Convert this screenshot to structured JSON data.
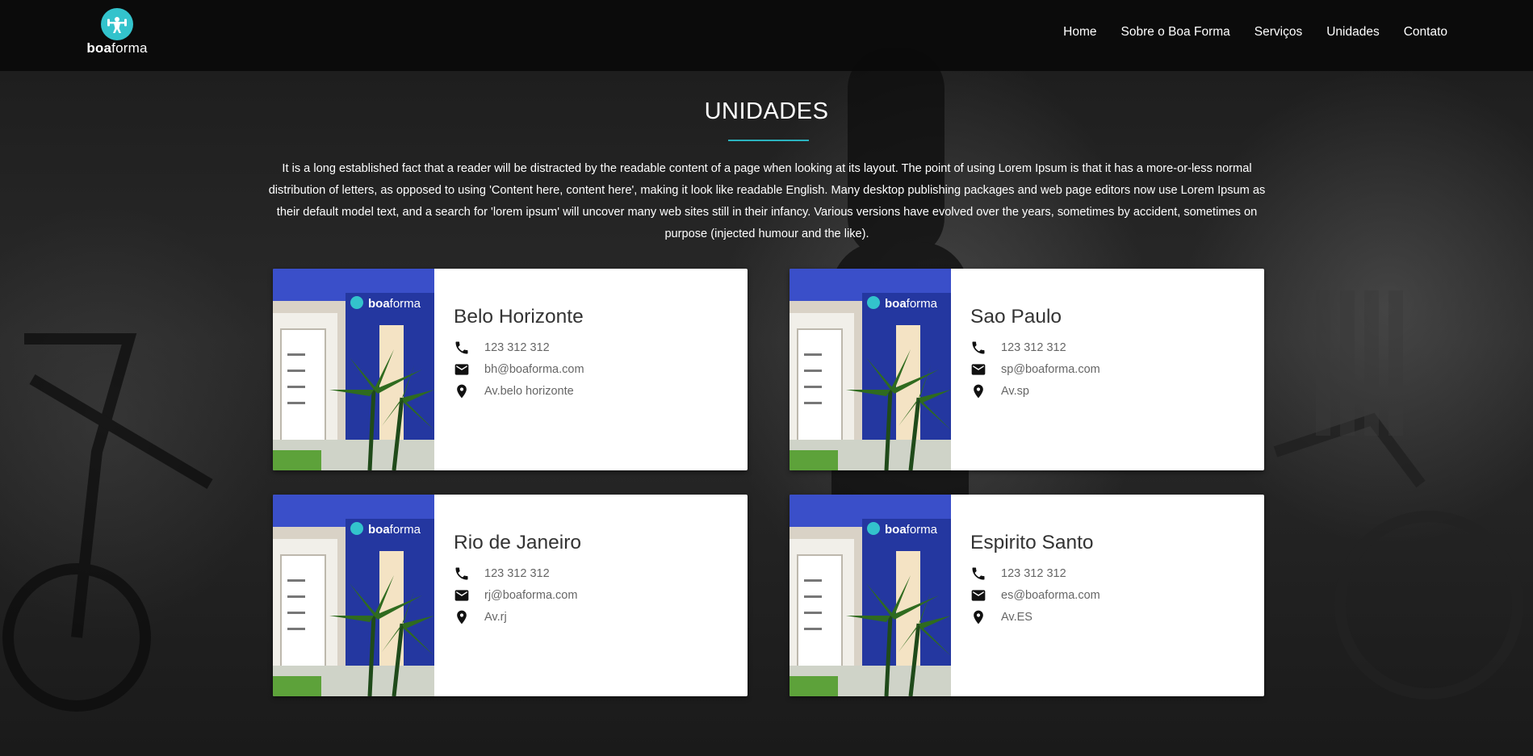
{
  "brand": {
    "logo_bold": "boa",
    "logo_light": "forma"
  },
  "nav": {
    "items": [
      {
        "label": "Home"
      },
      {
        "label": "Sobre o Boa Forma"
      },
      {
        "label": "Serviços"
      },
      {
        "label": "Unidades"
      },
      {
        "label": "Contato"
      }
    ]
  },
  "section": {
    "title": "UNIDADES",
    "intro": "It is a long established fact that a reader will be distracted by the readable content of a page when looking at its layout. The point of using Lorem Ipsum is that it has a more-or-less normal distribution of letters, as opposed to using 'Content here, content here', making it look like readable English. Many desktop publishing packages and web page editors now use Lorem Ipsum as their default model text, and a search for 'lorem ipsum' will uncover many web sites still in their infancy. Various versions have evolved over the years, sometimes by accident, sometimes on purpose (injected humour and the like)."
  },
  "units": [
    {
      "name": "Belo Horizonte",
      "phone": "123 312 312",
      "email": "bh@boaforma.com",
      "address": "Av.belo horizonte",
      "sign_bold": "boa",
      "sign_light": "forma"
    },
    {
      "name": "Sao Paulo",
      "phone": "123 312 312",
      "email": "sp@boaforma.com",
      "address": "Av.sp",
      "sign_bold": "boa",
      "sign_light": "forma"
    },
    {
      "name": "Rio de Janeiro",
      "phone": "123 312 312",
      "email": "rj@boaforma.com",
      "address": "Av.rj",
      "sign_bold": "boa",
      "sign_light": "forma"
    },
    {
      "name": "Espirito Santo",
      "phone": "123 312 312",
      "email": "es@boaforma.com",
      "address": "Av.ES",
      "sign_bold": "boa",
      "sign_light": "forma"
    }
  ],
  "icons": {
    "logo": "dumbbell-lifter-icon",
    "phone": "phone-icon",
    "email": "envelope-icon",
    "address": "map-pin-icon"
  },
  "colors": {
    "accent": "#2bb3bf",
    "navbar": "#0a0a0a",
    "card": "#ffffff",
    "storefront_blue": "#2a3aa8"
  }
}
